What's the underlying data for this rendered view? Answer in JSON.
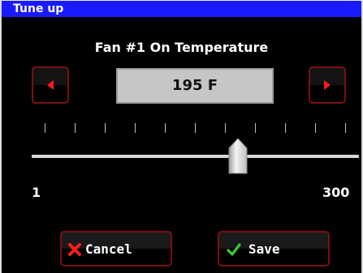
{
  "window": {
    "title": "Tune up"
  },
  "setting": {
    "title": "Fan #1 On Temperature",
    "value_display": "195 F",
    "value": 195,
    "unit": "F",
    "min_label": "1",
    "max_label": "300",
    "min": 1,
    "max": 300
  },
  "controls": {
    "decrement_icon": "arrow-left-icon",
    "increment_icon": "arrow-right-icon"
  },
  "actions": {
    "cancel_label": "Cancel",
    "cancel_icon": "x-mark-icon",
    "save_label": "Save",
    "save_icon": "checkmark-icon"
  },
  "colors": {
    "titlebar": "#1a1aff",
    "background": "#000000",
    "arrow": "#ff1a1a",
    "cancel_icon": "#ff1a1a",
    "save_icon": "#33cc33",
    "button_border": "#7a1010",
    "value_box": "#c6c6c6"
  }
}
